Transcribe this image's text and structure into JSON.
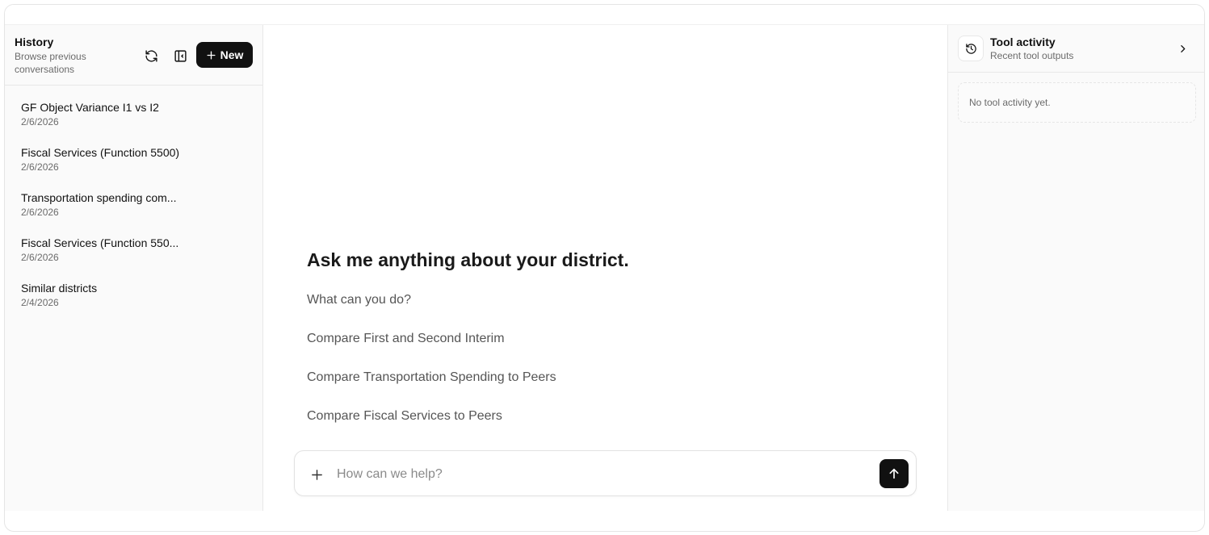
{
  "sidebar": {
    "title": "History",
    "subtitle": "Browse previous conversations",
    "new_label": "New",
    "items": [
      {
        "title": "GF Object Variance I1 vs I2",
        "date": "2/6/2026"
      },
      {
        "title": "Fiscal Services (Function 5500)",
        "date": "2/6/2026"
      },
      {
        "title": "Transportation spending com...",
        "date": "2/6/2026"
      },
      {
        "title": "Fiscal Services (Function 550...",
        "date": "2/6/2026"
      },
      {
        "title": "Similar districts",
        "date": "2/4/2026"
      }
    ]
  },
  "main": {
    "hero": "Ask me anything about your district.",
    "suggestions": [
      "What can you do?",
      "Compare First and Second Interim",
      "Compare Transportation Spending to Peers",
      "Compare Fiscal Services to Peers"
    ],
    "composer": {
      "placeholder": "How can we help?",
      "value": ""
    }
  },
  "tool_panel": {
    "title": "Tool activity",
    "subtitle": "Recent tool outputs",
    "empty_text": "No tool activity yet."
  },
  "icons": {
    "refresh": "refresh-icon",
    "collapse": "sidebar-collapse-icon",
    "new": "plus-icon",
    "attach": "plus-icon",
    "send": "arrow-up-icon",
    "history": "history-icon",
    "expand": "chevron-right-icon"
  },
  "colors": {
    "primary": "#111111",
    "muted_text": "#6b6b6b",
    "panel_bg": "#fafafa"
  }
}
